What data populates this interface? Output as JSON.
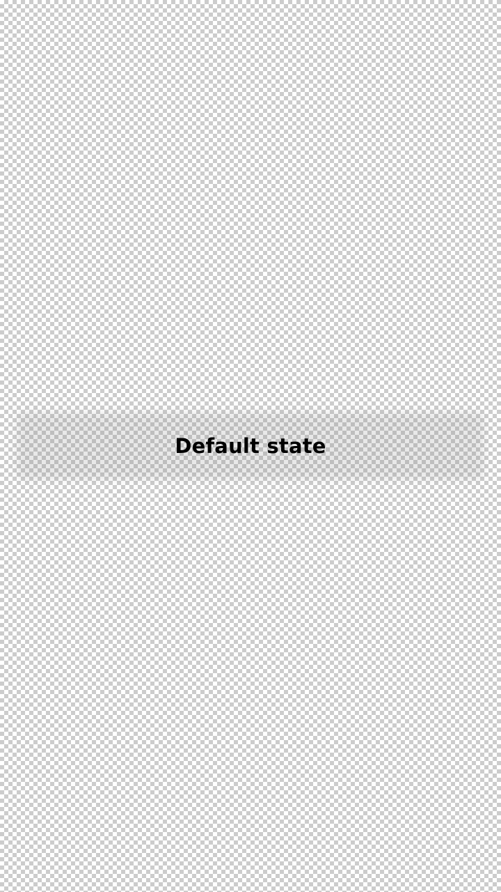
{
  "overlay": {
    "state_label": "Default state",
    "text_color": "#000000",
    "background_pattern": "transparency-checkerboard"
  }
}
